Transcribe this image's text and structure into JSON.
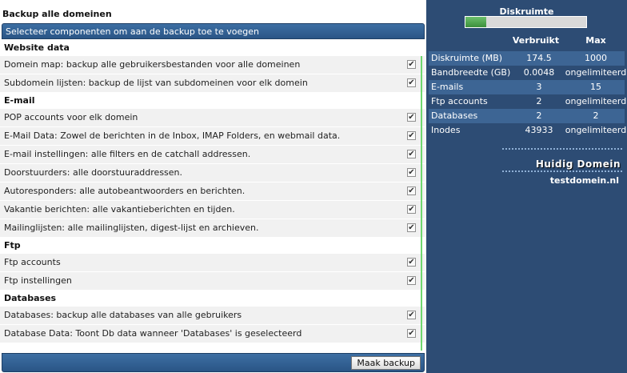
{
  "left": {
    "title": "Backup alle domeinen",
    "header": "Selecteer componenten om aan de backup toe te voegen",
    "sections": [
      {
        "heading": "Website data",
        "items": [
          {
            "label": "Domein map: backup alle gebruikersbestanden voor alle domeinen",
            "checked": true
          },
          {
            "label": "Subdomein lijsten: backup de lijst van subdomeinen voor elk domein",
            "checked": true
          }
        ]
      },
      {
        "heading": "E-mail",
        "items": [
          {
            "label": "POP accounts voor elk domein",
            "checked": true
          },
          {
            "label": "E-Mail Data: Zowel de berichten in de Inbox, IMAP Folders, en webmail data.",
            "checked": true
          },
          {
            "label": "E-mail instellingen: alle filters en de catchall addressen.",
            "checked": true
          },
          {
            "label": "Doorstuurders: alle doorstuuraddressen.",
            "checked": true
          },
          {
            "label": "Autoresponders: alle autobeantwoorders en berichten.",
            "checked": true
          },
          {
            "label": "Vakantie berichten: alle vakantieberichten en tijden.",
            "checked": true
          },
          {
            "label": "Mailinglijsten: alle mailinglijsten, digest-lijst en archieven.",
            "checked": true
          }
        ]
      },
      {
        "heading": "Ftp",
        "items": [
          {
            "label": "Ftp accounts",
            "checked": true
          },
          {
            "label": "Ftp instellingen",
            "checked": true
          }
        ]
      },
      {
        "heading": "Databases",
        "items": [
          {
            "label": "Databases: backup alle databases van alle gebruikers",
            "checked": true
          },
          {
            "label": "Database Data: Toont Db data wanneer 'Databases' is geselecteerd",
            "checked": true
          }
        ]
      }
    ],
    "button_label": "Maak backup"
  },
  "right": {
    "disk_title": "Diskruimte",
    "disk_usage_fraction": 0.17,
    "col_used": "Verbruikt",
    "col_max": "Max",
    "stats": [
      {
        "name": "Diskruimte (MB)",
        "used": "174.5",
        "max": "1000"
      },
      {
        "name": "Bandbreedte (GB)",
        "used": "0.0048",
        "max": "ongelimiteerd"
      },
      {
        "name": "E-mails",
        "used": "3",
        "max": "15"
      },
      {
        "name": "Ftp accounts",
        "used": "2",
        "max": "ongelimiteerd"
      },
      {
        "name": "Databases",
        "used": "2",
        "max": "2"
      },
      {
        "name": "Inodes",
        "used": "43933",
        "max": "ongelimiteerd"
      }
    ],
    "domain_label": "Huidig Domein",
    "domain_name": "testdomein.nl"
  },
  "colors": {
    "panel_blue": "#2d4c74",
    "header_blue": "#2a5586",
    "row_gray": "#f1f1f1",
    "accent_green": "#6fd86f"
  },
  "icons": {
    "checkbox": "check-icon"
  }
}
